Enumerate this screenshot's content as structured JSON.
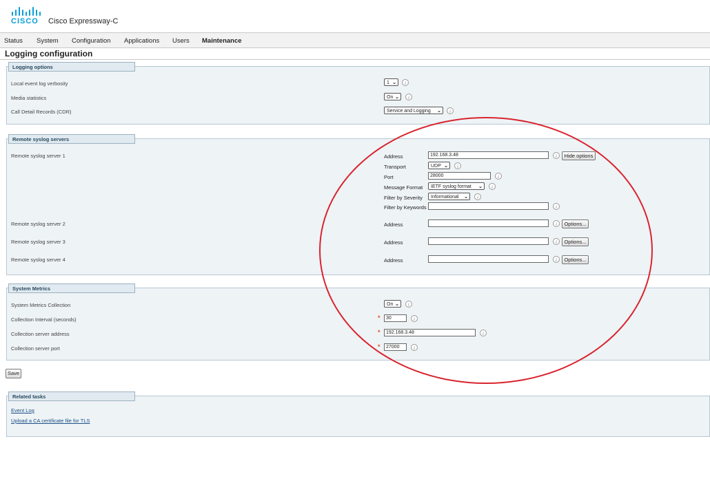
{
  "header": {
    "logo_text": "CISCO",
    "app_title": "Cisco Expressway-C"
  },
  "menu": [
    "Status",
    "System",
    "Configuration",
    "Applications",
    "Users",
    "Maintenance"
  ],
  "page_title": "Logging configuration",
  "logging_options": {
    "heading": "Logging options",
    "verbosity_label": "Local event log verbosity",
    "verbosity_value": "1",
    "media_label": "Media statistics",
    "media_value": "On",
    "cdr_label": "Call Detail Records (CDR)",
    "cdr_value": "Service and Logging"
  },
  "remote_syslog": {
    "heading": "Remote syslog servers",
    "server1": {
      "label": "Remote syslog server 1",
      "address_label": "Address",
      "address_value": "192.168.3.48",
      "hide_options": "Hide options",
      "transport_label": "Transport",
      "transport_value": "UDP",
      "port_label": "Port",
      "port_value": "28000",
      "format_label": "Message Format",
      "format_value": "IETF syslog format",
      "severity_label": "Filter by Severity",
      "severity_value": "Informational",
      "keywords_label": "Filter by Keywords",
      "keywords_value": ""
    },
    "server2": {
      "label": "Remote syslog server 2",
      "address_label": "Address",
      "address_value": "",
      "options": "Options..."
    },
    "server3": {
      "label": "Remote syslog server 3",
      "address_label": "Address",
      "address_value": "",
      "options": "Options..."
    },
    "server4": {
      "label": "Remote syslog server 4",
      "address_label": "Address",
      "address_value": "",
      "options": "Options..."
    }
  },
  "system_metrics": {
    "heading": "System Metrics",
    "collection_label": "System Metrics Collection",
    "collection_value": "On",
    "interval_label": "Collection Interval (seconds)",
    "interval_value": "30",
    "address_label": "Collection server address",
    "address_value": "192.168.3.48",
    "port_label": "Collection server port",
    "port_value": "27000",
    "required_mark": "*"
  },
  "save_label": "Save",
  "related_tasks": {
    "heading": "Related tasks",
    "links": [
      "Event Log",
      "Upload a CA certificate file for TLS"
    ]
  },
  "info_glyph": "i",
  "colors": {
    "cisco_blue": "#049fd9",
    "annotation_red": "#d9232d",
    "required_orange": "#e5522a"
  }
}
